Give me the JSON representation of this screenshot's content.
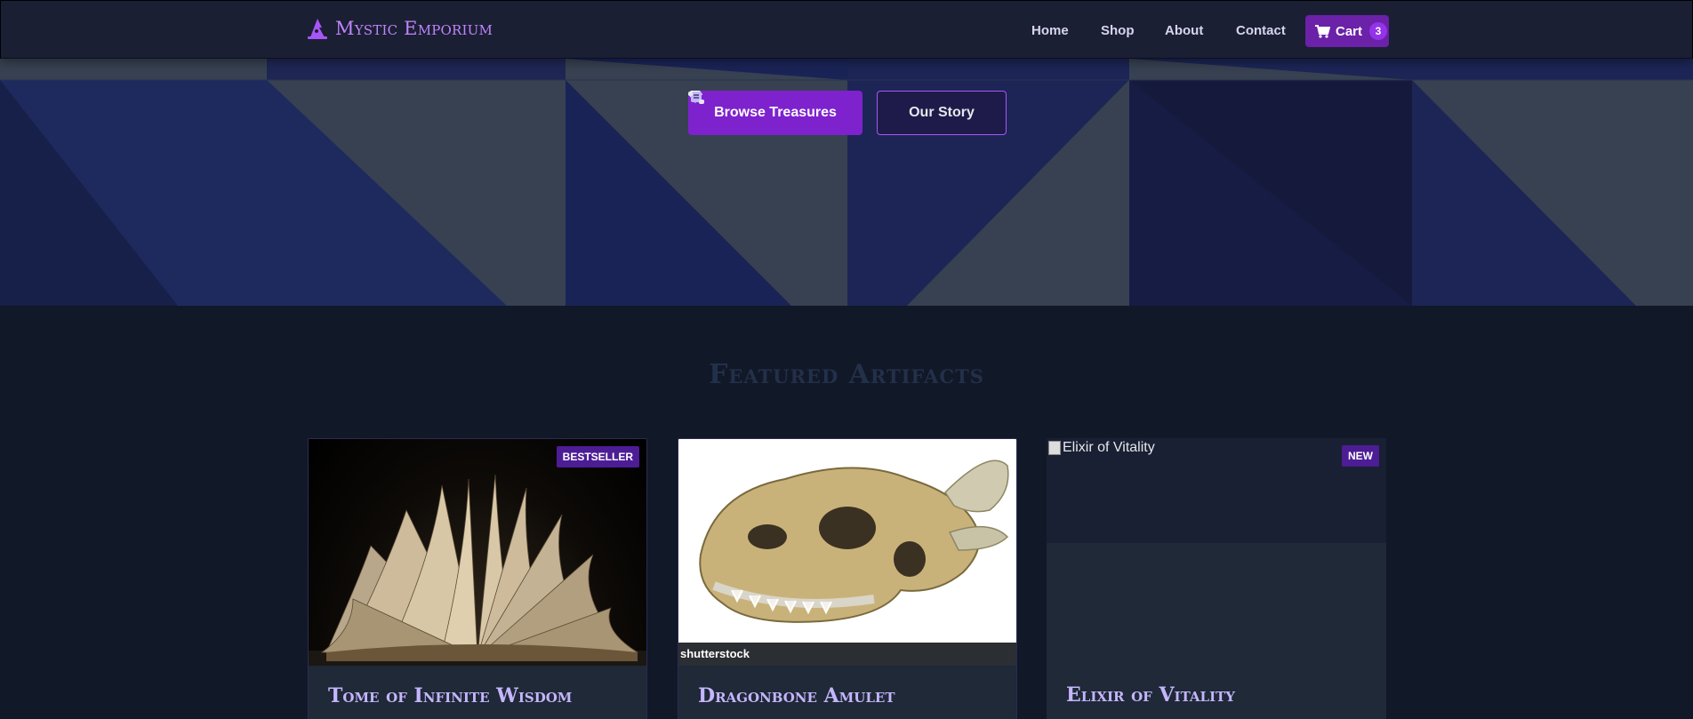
{
  "header": {
    "brand": "Mystic Emporium",
    "nav": {
      "home": "Home",
      "shop": "Shop",
      "about": "About",
      "contact": "Contact"
    },
    "cart": {
      "label": "Cart",
      "count": "3"
    }
  },
  "hero": {
    "primary_button": "Browse Treasures",
    "secondary_button": "Our Story"
  },
  "featured": {
    "title": "Featured Artifacts",
    "products": [
      {
        "name": "Tome of Infinite Wisdom",
        "badge": "BESTSELLER",
        "image_alt": ""
      },
      {
        "name": "Dragonbone Amulet",
        "badge": "",
        "image_watermark": "shutterstock"
      },
      {
        "name": "Elixir of Vitality",
        "badge": "NEW",
        "image_alt": "Elixir of Vitality"
      }
    ]
  },
  "colors": {
    "accent": "#7e22ce",
    "brand": "#c084fc",
    "page_bg": "#111827",
    "card_bg": "#1f2937"
  }
}
